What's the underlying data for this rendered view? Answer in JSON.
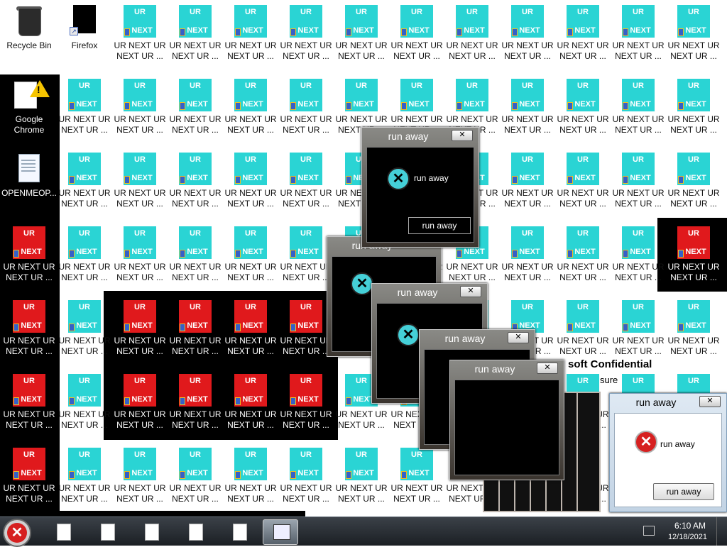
{
  "desktop": {
    "icons": {
      "recycle_bin": "Recycle Bin",
      "firefox": "Firefox",
      "chrome": "Google Chrome",
      "openmeop": "OPENMEOP...",
      "ur_top": "UR",
      "ur_bottom": "NEXT",
      "ur_label": "UR NEXT UR NEXT UR ..."
    },
    "confidential": "soft Confidential",
    "confidential_sub": "sure"
  },
  "dialogs": {
    "title": "run away",
    "message": "run away",
    "button": "run away",
    "close": "✕"
  },
  "taskbar": {
    "time": "6:10 AM",
    "date": "12/18/2021"
  },
  "colors": {
    "ur_tile": "#2ad4d4",
    "ur_tile_red": "#e0191c",
    "taskbar": "#1b1f24"
  }
}
